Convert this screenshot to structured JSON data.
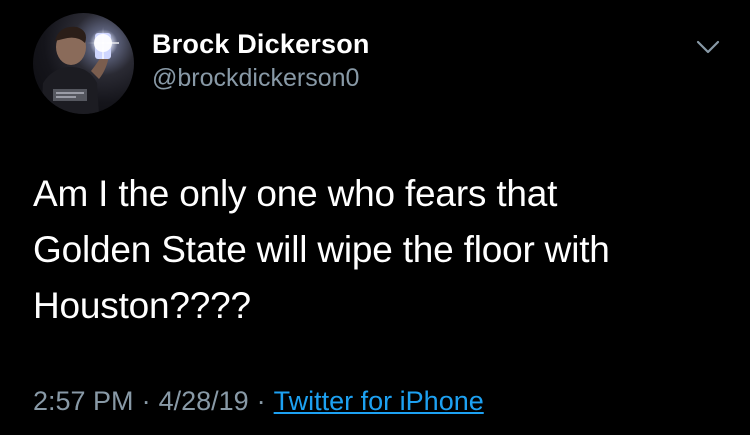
{
  "tweet": {
    "author": {
      "display_name": "Brock Dickerson",
      "handle": "@brockdickerson0"
    },
    "text_lines": [
      "Am I the only one who fears that",
      "Golden State will wipe the floor with",
      "Houston????"
    ],
    "meta": {
      "time": "2:57 PM",
      "separator": "·",
      "date": "4/28/19",
      "source": "Twitter for iPhone"
    },
    "more_icon": "chevron-down-icon"
  },
  "colors": {
    "background": "#000000",
    "text_primary": "#ffffff",
    "text_secondary": "#8899a6",
    "link": "#1da1f2"
  }
}
